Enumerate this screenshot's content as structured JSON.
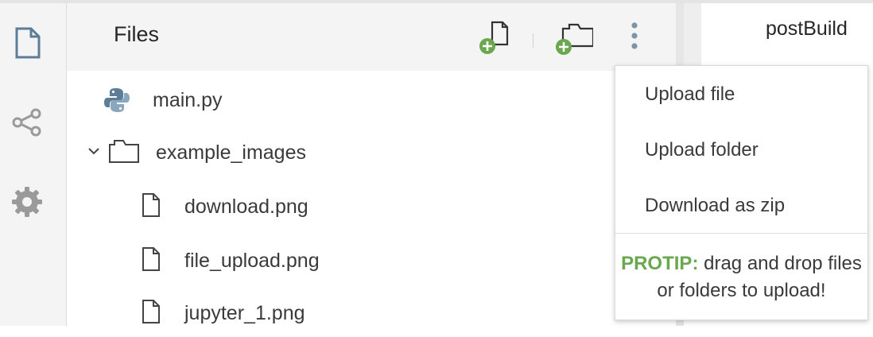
{
  "panel": {
    "title": "Files",
    "toolbar": {
      "new_file_icon": "new-file-plus",
      "new_folder_icon": "new-folder-plus",
      "more_icon": "vertical-ellipsis"
    }
  },
  "rail": {
    "items": [
      {
        "name": "files",
        "icon": "document"
      },
      {
        "name": "git",
        "icon": "share-graph"
      },
      {
        "name": "settings",
        "icon": "gear"
      }
    ]
  },
  "files": [
    {
      "name": "main.py",
      "type": "python"
    },
    {
      "name": "example_images",
      "type": "folder",
      "expanded": true
    },
    {
      "name": "download.png",
      "type": "file"
    },
    {
      "name": "file_upload.png",
      "type": "file"
    },
    {
      "name": "jupyter_1.png",
      "type": "file"
    }
  ],
  "editor": {
    "tab_label": "postBuild"
  },
  "menu": {
    "items": [
      "Upload file",
      "Upload folder",
      "Download as zip"
    ],
    "protip_label": "PROTIP:",
    "protip_text": "drag and drop files or folders to upload!"
  },
  "colors": {
    "accent_green": "#6aa84f",
    "icon_blue": "#5b7d98",
    "rail_bg": "#f4f4f4"
  }
}
